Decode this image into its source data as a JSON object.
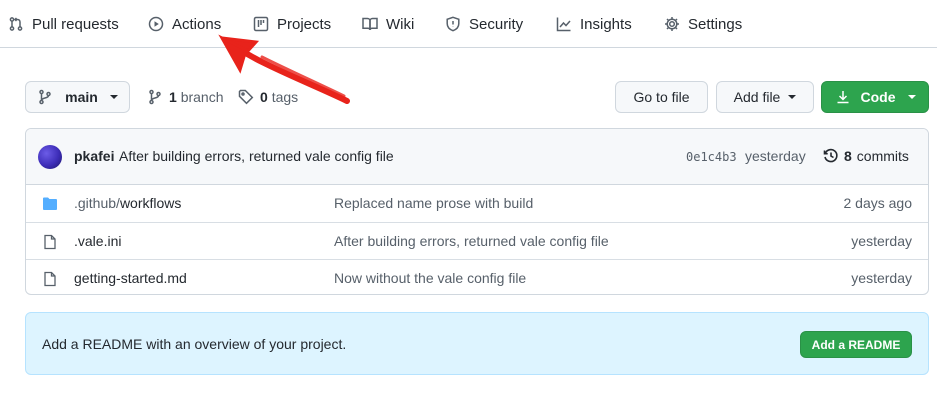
{
  "nav": {
    "items": [
      {
        "label": "Pull requests",
        "icon": "pull-request-icon"
      },
      {
        "label": "Actions",
        "icon": "play-icon"
      },
      {
        "label": "Projects",
        "icon": "table-icon"
      },
      {
        "label": "Wiki",
        "icon": "book-icon"
      },
      {
        "label": "Security",
        "icon": "shield-icon"
      },
      {
        "label": "Insights",
        "icon": "graph-icon"
      },
      {
        "label": "Settings",
        "icon": "gear-icon"
      }
    ]
  },
  "toolbar": {
    "branch_select": "main",
    "branch_count": "1",
    "branch_label": "branch",
    "tag_count": "0",
    "tag_label": "tags",
    "go_to_file": "Go to file",
    "add_file": "Add file",
    "code": "Code"
  },
  "commit": {
    "author": "pkafei",
    "message": "After building errors, returned vale config file",
    "sha": "0e1c4b3",
    "when": "yesterday",
    "count": "8",
    "count_label": "commits"
  },
  "files": [
    {
      "name_dim": ".github/",
      "name": "workflows",
      "type": "folder",
      "message": "Replaced name prose with build",
      "when": "2 days ago"
    },
    {
      "name_dim": "",
      "name": ".vale.ini",
      "type": "file",
      "message": "After building errors, returned vale config file",
      "when": "yesterday"
    },
    {
      "name_dim": "",
      "name": "getting-started.md",
      "type": "file",
      "message": "Now without the vale config file",
      "when": "yesterday"
    }
  ],
  "readme": {
    "text": "Add a README with an overview of your project.",
    "button": "Add a README"
  },
  "colors": {
    "accent_green": "#2da44e",
    "annotation_red": "#e8231b",
    "readme_bg": "#ddf4ff",
    "folder_blue": "#54aeff"
  }
}
